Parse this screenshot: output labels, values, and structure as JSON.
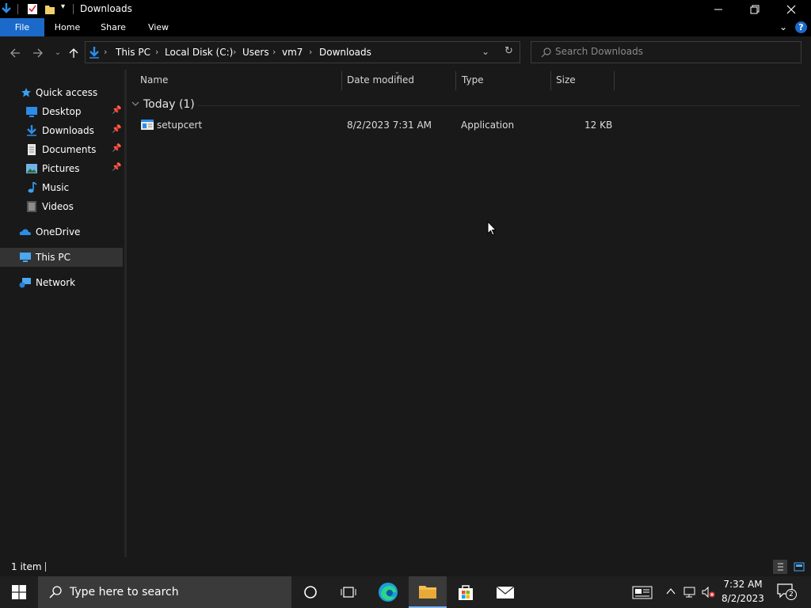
{
  "window": {
    "title": "Downloads"
  },
  "ribbon": {
    "tabs": [
      {
        "label": "File"
      },
      {
        "label": "Home"
      },
      {
        "label": "Share"
      },
      {
        "label": "View"
      }
    ]
  },
  "address": {
    "crumbs": [
      "This PC",
      "Local Disk (C:)",
      "Users",
      "vm7",
      "Downloads"
    ]
  },
  "search": {
    "placeholder": "Search Downloads"
  },
  "nav": {
    "quick_access": "Quick access",
    "items": [
      {
        "label": "Desktop",
        "icon": "desktop-icon",
        "pinned": true
      },
      {
        "label": "Downloads",
        "icon": "downloads-icon",
        "pinned": true
      },
      {
        "label": "Documents",
        "icon": "documents-icon",
        "pinned": true
      },
      {
        "label": "Pictures",
        "icon": "pictures-icon",
        "pinned": true
      },
      {
        "label": "Music",
        "icon": "music-icon",
        "pinned": false
      },
      {
        "label": "Videos",
        "icon": "videos-icon",
        "pinned": false
      }
    ],
    "onedrive": "OneDrive",
    "this_pc": "This PC",
    "network": "Network"
  },
  "columns": {
    "name": "Name",
    "date": "Date modified",
    "type": "Type",
    "size": "Size"
  },
  "group": {
    "label": "Today (1)"
  },
  "files": [
    {
      "name": "setupcert",
      "date": "8/2/2023 7:31 AM",
      "type": "Application",
      "size": "12 KB"
    }
  ],
  "status": {
    "count": "1 item"
  },
  "taskbar": {
    "search_placeholder": "Type here to search",
    "time": "7:32 AM",
    "date": "8/2/2023",
    "notification_count": "2"
  },
  "colors": {
    "accent": "#1b6ac9",
    "background": "#191919",
    "taskbar": "#1f1f1f"
  }
}
